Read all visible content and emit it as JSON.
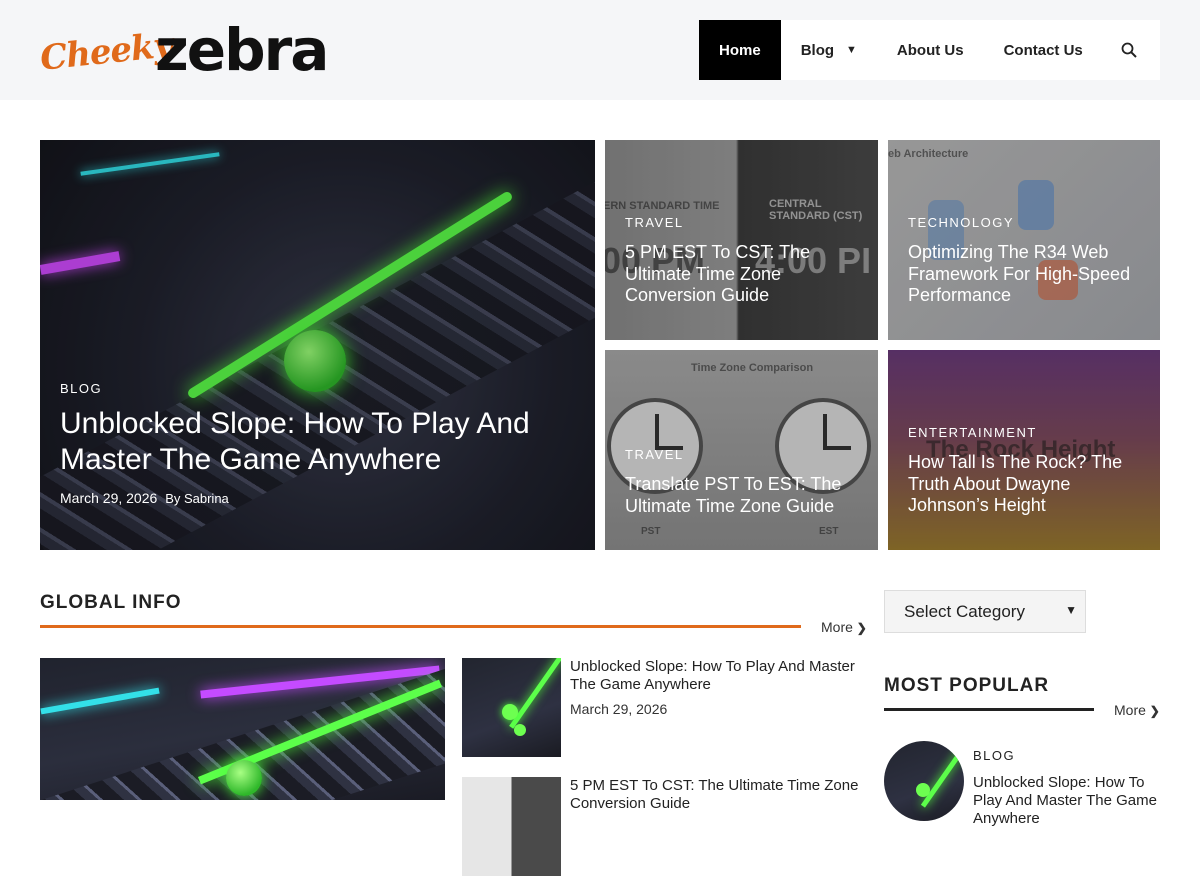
{
  "brand": {
    "logo_word1": "Cheeky",
    "logo_word2": "zebra",
    "accent": "#e06a1b"
  },
  "nav": {
    "items": [
      {
        "label": "Home",
        "active": true
      },
      {
        "label": "Blog",
        "has_submenu": true
      },
      {
        "label": "About Us"
      },
      {
        "label": "Contact Us"
      }
    ],
    "search_icon": "search-icon"
  },
  "hero": {
    "featured": {
      "category": "BLOG",
      "title": "Unblocked Slope: How To Play And Master The Game Anywhere",
      "date": "March 29, 2026",
      "author": "By Sabrina"
    },
    "tiles": [
      {
        "category": "TRAVEL",
        "title": "5 PM EST To CST: The Ultimate Time Zone Conversion Guide",
        "bg_text_left": "ERN STANDARD TIME",
        "bg_text_right": "CENTRAL STANDARD (CST)",
        "bg_big_left": "00 PM",
        "bg_big_right": "4:00 PI"
      },
      {
        "category": "TECHNOLOGY",
        "title": "Optimizing The R34 Web Framework For High-Speed Performance",
        "bg_text": "eb Architecture"
      },
      {
        "category": "TRAVEL",
        "title": "Translate PST To EST: The Ultimate Time Zone Guide",
        "bg_text": "Time Zone Comparison",
        "bg_left": "PST",
        "bg_right": "EST"
      },
      {
        "category": "ENTERTAINMENT",
        "title": "How Tall Is The Rock? The Truth About Dwayne Johnson’s Height",
        "bg_text": "The Rock Height"
      }
    ]
  },
  "global_info": {
    "heading": "GLOBAL INFO",
    "more_label": "More",
    "list": [
      {
        "title": "Unblocked Slope: How To Play And Master The Game Anywhere",
        "date": "March 29, 2026"
      },
      {
        "title": "5 PM EST To CST: The Ultimate Time Zone Conversion Guide",
        "date": ""
      }
    ]
  },
  "sidebar": {
    "category_select": "Select Category",
    "most_popular": {
      "heading": "MOST POPULAR",
      "more_label": "More",
      "items": [
        {
          "category": "BLOG",
          "title": "Unblocked Slope: How To Play And Master The Game Anywhere"
        }
      ]
    }
  }
}
